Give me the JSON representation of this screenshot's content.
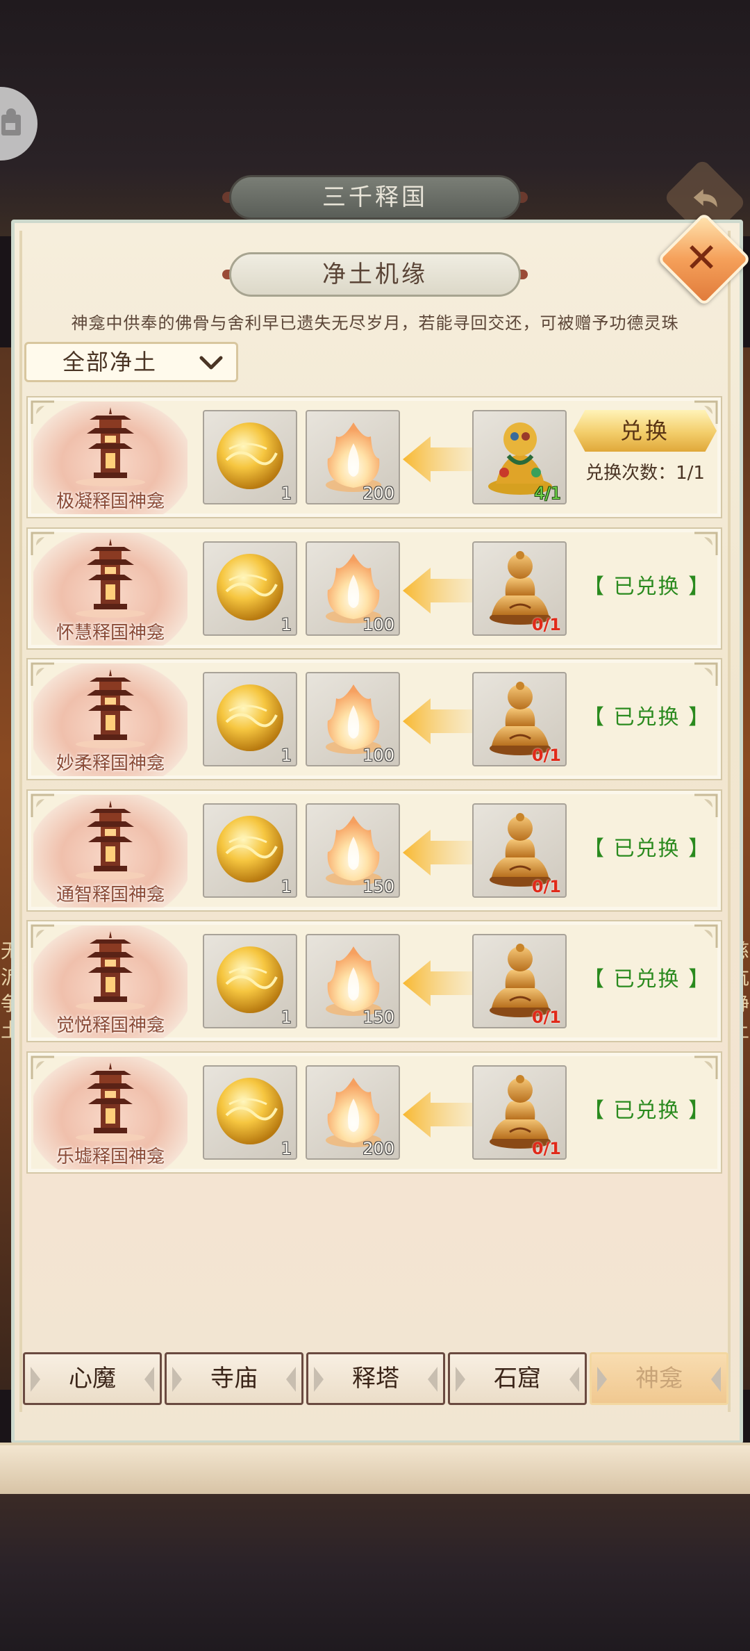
{
  "header": {
    "outer_title": "三千释国",
    "panel_title": "净土机缘",
    "description": "神龛中供奉的佛骨与舍利早已遗失无尽岁月，若能寻回交还，可被赠予功德灵珠"
  },
  "filter": {
    "selected": "全部净土"
  },
  "rows": [
    {
      "shrine_name": "极凝释国神龛",
      "orb_count": "1",
      "flame_count": "200",
      "reward_count": "4/1",
      "reward_type": "relic",
      "status": "available",
      "button_label": "兑换",
      "exchange_times": "兑换次数：1/1"
    },
    {
      "shrine_name": "怀慧释国神龛",
      "orb_count": "1",
      "flame_count": "100",
      "reward_count": "0/1",
      "reward_type": "buddha",
      "status": "【 已兑换 】"
    },
    {
      "shrine_name": "妙柔释国神龛",
      "orb_count": "1",
      "flame_count": "100",
      "reward_count": "0/1",
      "reward_type": "buddha",
      "status": "【 已兑换 】"
    },
    {
      "shrine_name": "通智释国神龛",
      "orb_count": "1",
      "flame_count": "150",
      "reward_count": "0/1",
      "reward_type": "buddha",
      "status": "【 已兑换 】"
    },
    {
      "shrine_name": "觉悦释国神龛",
      "orb_count": "1",
      "flame_count": "150",
      "reward_count": "0/1",
      "reward_type": "buddha",
      "status": "【 已兑换 】"
    },
    {
      "shrine_name": "乐墟释国神龛",
      "orb_count": "1",
      "flame_count": "200",
      "reward_count": "0/1",
      "reward_type": "buddha",
      "status": "【 已兑换 】"
    }
  ],
  "tabs": [
    {
      "label": "心魔",
      "active": false
    },
    {
      "label": "寺庙",
      "active": false
    },
    {
      "label": "释塔",
      "active": false
    },
    {
      "label": "石窟",
      "active": false
    },
    {
      "label": "神龛",
      "active": true
    }
  ],
  "side_text": {
    "left": [
      "无",
      "沂",
      "争",
      "土"
    ],
    "right": [
      "慈",
      "沆",
      "静",
      "土"
    ]
  },
  "colors": {
    "accent_green": "#2a8a1e",
    "count_red": "#e02a1a",
    "count_green": "#6fd24a",
    "button_gold": "#f3cd6a"
  },
  "icons": {
    "close": "close-icon",
    "back": "back-arrow-icon",
    "filter": "chevron-down-icon",
    "arrow": "arrow-left-icon"
  }
}
